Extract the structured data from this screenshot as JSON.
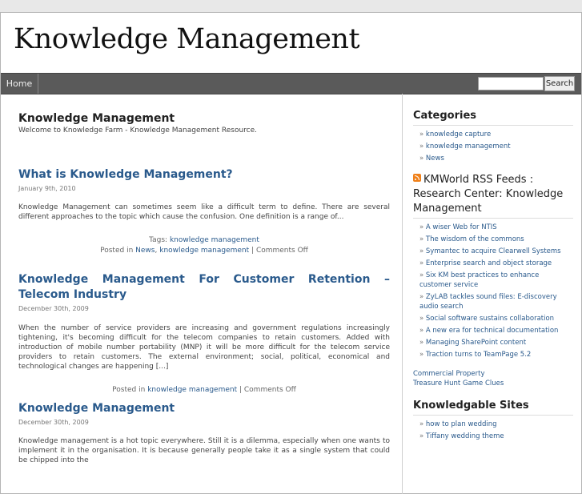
{
  "site": {
    "title": "Knowledge Management"
  },
  "nav": {
    "home": "Home"
  },
  "search": {
    "placeholder": "",
    "button": "Search"
  },
  "intro": {
    "title": "Knowledge Management",
    "text": "Welcome to Knowledge Farm - Knowledge Management Resource."
  },
  "posts": [
    {
      "title": "What is Knowledge Management?",
      "date": "January 9th, 2010",
      "excerpt": "Knowledge Management can sometimes seem like a difficult term to define. There are several different approaches to the topic which cause the confusion. One definition is a range of...",
      "tags_label": "Tags:",
      "tags": [
        "knowledge management"
      ],
      "posted_in_label": "Posted in",
      "categories": [
        "News",
        "knowledge management"
      ],
      "sep": ",",
      "comments": "Comments Off"
    },
    {
      "title": "Knowledge Management For Customer Retention – Telecom Industry",
      "date": "December 30th, 2009",
      "excerpt": "When the number of service providers are increasing and government regulations increasingly tightening, it's becoming difficult for the telecom companies to retain customers. Added with introduction of mobile number portability (MNP) it will be more difficult for the telecom service providers to retain customers. The external environment; social, political, economical and technological changes are happening [...]",
      "posted_in_label": "Posted in",
      "categories": [
        "knowledge management"
      ],
      "comments": "Comments Off"
    },
    {
      "title": "Knowledge Management",
      "date": "December 30th, 2009",
      "excerpt": "Knowledge management is a hot topic everywhere. Still it is a dilemma, especially when one wants to implement it in the organisation. It is because generally people take it as a single system that could be chipped into the"
    }
  ],
  "sidebar": {
    "categories_title": "Categories",
    "categories": [
      "knowledge capture",
      "knowledge management",
      "News"
    ],
    "rss_title": "KMWorld RSS Feeds : Research Center: Knowledge Management",
    "rss_items": [
      "A wiser Web for NTIS",
      "The wisdom of the commons",
      "Symantec to acquire Clearwell Systems",
      "Enterprise search and object storage",
      "Six KM best practices to enhance customer service",
      "ZyLAB tackles sound files: E-discovery audio search",
      "Social software sustains collaboration",
      "A new era for technical documentation",
      "Managing SharePoint content",
      "Traction turns to TeamPage 5.2"
    ],
    "extra_links": [
      "Commercial Property",
      "Treasure Hunt Game Clues"
    ],
    "sites_title": "Knowledgable Sites",
    "sites": [
      "how to plan wedding",
      "Tiffany wedding theme"
    ]
  },
  "colors": {
    "link": "#2a5a8c",
    "navbar": "#5a5a5a",
    "rss": "#f0811a"
  }
}
